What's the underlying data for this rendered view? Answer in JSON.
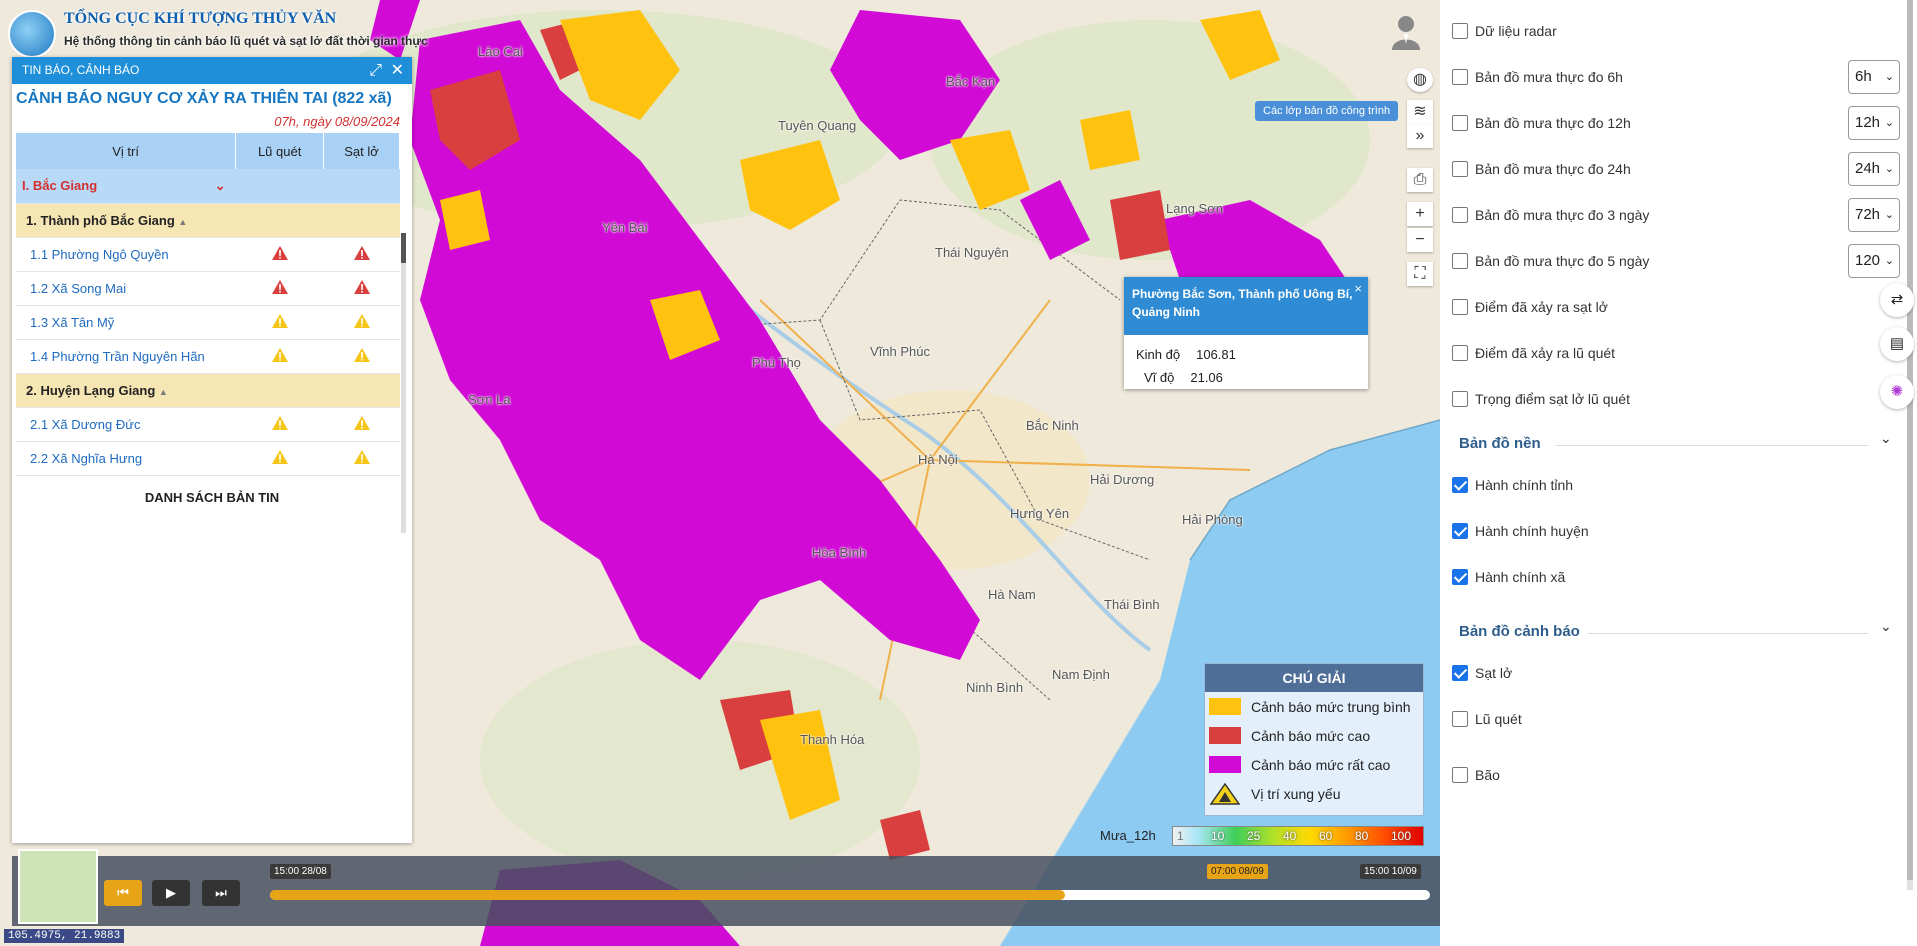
{
  "header": {
    "org": "TỔNG CỤC KHÍ TƯỢNG THỦY VĂN",
    "system": "Hệ thống thông tin cảnh báo lũ quét và sạt lở đất thời gian thực"
  },
  "panel": {
    "header_label": "TIN BÁO, CẢNH BÁO",
    "expand_icon": "⤢",
    "close_icon": "✕",
    "title": "CẢNH BÁO NGUY CƠ XẢY RA THIÊN TAI (822 xã)",
    "date": "07h, ngày 08/09/2024",
    "columns": [
      "Vị trí",
      "Lũ quét",
      "Sạt lở"
    ],
    "province": "I. Bắc Giang",
    "district1": "1. Thành phố Bắc Giang",
    "district2": "2. Huyện Lạng Giang",
    "wards": [
      {
        "name": "1.1 Phường Ngô Quyền",
        "flash": "red",
        "landslide": "red"
      },
      {
        "name": "1.2 Xã Song Mai",
        "flash": "red",
        "landslide": "red"
      },
      {
        "name": "1.3 Xã Tân Mỹ",
        "flash": "yellow",
        "landslide": "yellow"
      },
      {
        "name": "1.4 Phường Trần Nguyên Hãn",
        "flash": "yellow",
        "landslide": "yellow"
      },
      {
        "name": "2.1 Xã Dương Đức",
        "flash": "yellow",
        "landslide": "yellow"
      },
      {
        "name": "2.2 Xã Nghĩa Hưng",
        "flash": "yellow",
        "landslide": "yellow"
      }
    ],
    "list_link": "DANH SÁCH BẢN TIN"
  },
  "map": {
    "places": [
      {
        "name": "Lào Cai"
      },
      {
        "name": "Bắc Kạn"
      },
      {
        "name": "Tuyên Quang"
      },
      {
        "name": "Yên Bái"
      },
      {
        "name": "Lạng Sơn"
      },
      {
        "name": "Thái Nguyên"
      },
      {
        "name": "Phú Thọ"
      },
      {
        "name": "Vĩnh Phúc"
      },
      {
        "name": "Bắc Ninh"
      },
      {
        "name": "Hà Nội"
      },
      {
        "name": "Hải Dương"
      },
      {
        "name": "Hưng Yên"
      },
      {
        "name": "Hải Phòng"
      },
      {
        "name": "Hòa Bình"
      },
      {
        "name": "Hà Nam"
      },
      {
        "name": "Thái Bình"
      },
      {
        "name": "Nam Định"
      },
      {
        "name": "Ninh Bình"
      },
      {
        "name": "Thanh Hóa"
      },
      {
        "name": "Sơn La"
      }
    ],
    "layers_tip": "Các lớp bản đồ công trình",
    "coords": "105.4975, 21.9883"
  },
  "popup": {
    "title": "Phường Bắc Sơn, Thành phố Uông Bí, Quảng Ninh",
    "lon_label": "Kinh độ",
    "lon": "106.81",
    "lat_label": "Vĩ độ",
    "lat": "21.06",
    "close": "×"
  },
  "legend": {
    "title": "CHÚ GIẢI",
    "items": [
      {
        "label": "Cảnh báo mức trung bình",
        "color": "#ffc20e"
      },
      {
        "label": "Cảnh báo mức cao",
        "color": "#d93f3f"
      },
      {
        "label": "Cảnh báo mức rất cao",
        "color": "#d10ad6"
      },
      {
        "label": "Vị trí xung yếu",
        "color": "#f2d21b"
      }
    ]
  },
  "rain_scale": {
    "label": "Mưa_12h",
    "ticks": [
      "1",
      "10",
      "25",
      "40",
      "60",
      "80",
      "100"
    ]
  },
  "timeline": {
    "start": "15:00 28/08",
    "current": "07:00 08/09",
    "end": "15:00 10/09",
    "progress": 0.685
  },
  "sidebar": {
    "options": [
      {
        "label": "Dữ liệu radar",
        "checked": false
      },
      {
        "label": "Bản đồ mưa thực đo 6h",
        "checked": false,
        "select": "6h"
      },
      {
        "label": "Bản đồ mưa thực đo 12h",
        "checked": false,
        "select": "12h"
      },
      {
        "label": "Bản đồ mưa thực đo 24h",
        "checked": false,
        "select": "24h"
      },
      {
        "label": "Bản đồ mưa thực đo 3 ngày",
        "checked": false,
        "select": "72h"
      },
      {
        "label": "Bản đồ mưa thực đo 5 ngày",
        "checked": false,
        "select": "120"
      },
      {
        "label": "Điểm đã xảy ra sạt lở",
        "checked": false
      },
      {
        "label": "Điểm đã xảy ra lũ quét",
        "checked": false
      },
      {
        "label": "Trọng điểm sạt lở lũ quét",
        "checked": false
      }
    ],
    "base_section": "Bản đồ nền",
    "base_options": [
      {
        "label": "Hành chính tỉnh",
        "checked": true
      },
      {
        "label": "Hành chính huyện",
        "checked": true
      },
      {
        "label": "Hành chính xã",
        "checked": true
      }
    ],
    "warn_section": "Bản đồ cảnh báo",
    "warn_options": [
      {
        "label": "Sạt lở",
        "checked": true
      },
      {
        "label": "Lũ quét",
        "checked": false
      },
      {
        "label": "Bão",
        "checked": false
      }
    ]
  },
  "colors": {
    "medium": "#ffc20e",
    "high": "#d93f3f",
    "very_high": "#d10ad6",
    "sea": "#8ecbf2",
    "land": "#efe9dc"
  }
}
